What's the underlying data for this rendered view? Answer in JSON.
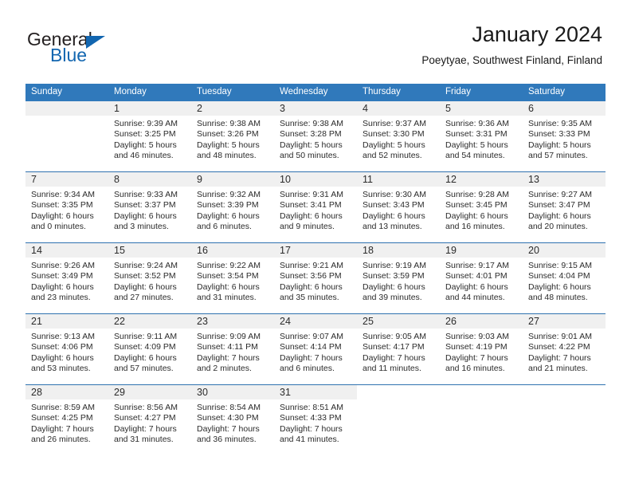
{
  "brand": {
    "name_part1": "General",
    "name_part2": "Blue",
    "accent_color": "#1266b0"
  },
  "header": {
    "title": "January 2024",
    "subtitle": "Poeytyae, Southwest Finland, Finland"
  },
  "calendar": {
    "header_bg": "#3079bb",
    "separator_color": "#2f72b0",
    "daynum_bg": "#f0f0f0",
    "weekday_headers": [
      "Sunday",
      "Monday",
      "Tuesday",
      "Wednesday",
      "Thursday",
      "Friday",
      "Saturday"
    ],
    "weeks": [
      [
        {
          "day": "",
          "lines": []
        },
        {
          "day": "1",
          "lines": [
            "Sunrise: 9:39 AM",
            "Sunset: 3:25 PM",
            "Daylight: 5 hours",
            "and 46 minutes."
          ]
        },
        {
          "day": "2",
          "lines": [
            "Sunrise: 9:38 AM",
            "Sunset: 3:26 PM",
            "Daylight: 5 hours",
            "and 48 minutes."
          ]
        },
        {
          "day": "3",
          "lines": [
            "Sunrise: 9:38 AM",
            "Sunset: 3:28 PM",
            "Daylight: 5 hours",
            "and 50 minutes."
          ]
        },
        {
          "day": "4",
          "lines": [
            "Sunrise: 9:37 AM",
            "Sunset: 3:30 PM",
            "Daylight: 5 hours",
            "and 52 minutes."
          ]
        },
        {
          "day": "5",
          "lines": [
            "Sunrise: 9:36 AM",
            "Sunset: 3:31 PM",
            "Daylight: 5 hours",
            "and 54 minutes."
          ]
        },
        {
          "day": "6",
          "lines": [
            "Sunrise: 9:35 AM",
            "Sunset: 3:33 PM",
            "Daylight: 5 hours",
            "and 57 minutes."
          ]
        }
      ],
      [
        {
          "day": "7",
          "lines": [
            "Sunrise: 9:34 AM",
            "Sunset: 3:35 PM",
            "Daylight: 6 hours",
            "and 0 minutes."
          ]
        },
        {
          "day": "8",
          "lines": [
            "Sunrise: 9:33 AM",
            "Sunset: 3:37 PM",
            "Daylight: 6 hours",
            "and 3 minutes."
          ]
        },
        {
          "day": "9",
          "lines": [
            "Sunrise: 9:32 AM",
            "Sunset: 3:39 PM",
            "Daylight: 6 hours",
            "and 6 minutes."
          ]
        },
        {
          "day": "10",
          "lines": [
            "Sunrise: 9:31 AM",
            "Sunset: 3:41 PM",
            "Daylight: 6 hours",
            "and 9 minutes."
          ]
        },
        {
          "day": "11",
          "lines": [
            "Sunrise: 9:30 AM",
            "Sunset: 3:43 PM",
            "Daylight: 6 hours",
            "and 13 minutes."
          ]
        },
        {
          "day": "12",
          "lines": [
            "Sunrise: 9:28 AM",
            "Sunset: 3:45 PM",
            "Daylight: 6 hours",
            "and 16 minutes."
          ]
        },
        {
          "day": "13",
          "lines": [
            "Sunrise: 9:27 AM",
            "Sunset: 3:47 PM",
            "Daylight: 6 hours",
            "and 20 minutes."
          ]
        }
      ],
      [
        {
          "day": "14",
          "lines": [
            "Sunrise: 9:26 AM",
            "Sunset: 3:49 PM",
            "Daylight: 6 hours",
            "and 23 minutes."
          ]
        },
        {
          "day": "15",
          "lines": [
            "Sunrise: 9:24 AM",
            "Sunset: 3:52 PM",
            "Daylight: 6 hours",
            "and 27 minutes."
          ]
        },
        {
          "day": "16",
          "lines": [
            "Sunrise: 9:22 AM",
            "Sunset: 3:54 PM",
            "Daylight: 6 hours",
            "and 31 minutes."
          ]
        },
        {
          "day": "17",
          "lines": [
            "Sunrise: 9:21 AM",
            "Sunset: 3:56 PM",
            "Daylight: 6 hours",
            "and 35 minutes."
          ]
        },
        {
          "day": "18",
          "lines": [
            "Sunrise: 9:19 AM",
            "Sunset: 3:59 PM",
            "Daylight: 6 hours",
            "and 39 minutes."
          ]
        },
        {
          "day": "19",
          "lines": [
            "Sunrise: 9:17 AM",
            "Sunset: 4:01 PM",
            "Daylight: 6 hours",
            "and 44 minutes."
          ]
        },
        {
          "day": "20",
          "lines": [
            "Sunrise: 9:15 AM",
            "Sunset: 4:04 PM",
            "Daylight: 6 hours",
            "and 48 minutes."
          ]
        }
      ],
      [
        {
          "day": "21",
          "lines": [
            "Sunrise: 9:13 AM",
            "Sunset: 4:06 PM",
            "Daylight: 6 hours",
            "and 53 minutes."
          ]
        },
        {
          "day": "22",
          "lines": [
            "Sunrise: 9:11 AM",
            "Sunset: 4:09 PM",
            "Daylight: 6 hours",
            "and 57 minutes."
          ]
        },
        {
          "day": "23",
          "lines": [
            "Sunrise: 9:09 AM",
            "Sunset: 4:11 PM",
            "Daylight: 7 hours",
            "and 2 minutes."
          ]
        },
        {
          "day": "24",
          "lines": [
            "Sunrise: 9:07 AM",
            "Sunset: 4:14 PM",
            "Daylight: 7 hours",
            "and 6 minutes."
          ]
        },
        {
          "day": "25",
          "lines": [
            "Sunrise: 9:05 AM",
            "Sunset: 4:17 PM",
            "Daylight: 7 hours",
            "and 11 minutes."
          ]
        },
        {
          "day": "26",
          "lines": [
            "Sunrise: 9:03 AM",
            "Sunset: 4:19 PM",
            "Daylight: 7 hours",
            "and 16 minutes."
          ]
        },
        {
          "day": "27",
          "lines": [
            "Sunrise: 9:01 AM",
            "Sunset: 4:22 PM",
            "Daylight: 7 hours",
            "and 21 minutes."
          ]
        }
      ],
      [
        {
          "day": "28",
          "lines": [
            "Sunrise: 8:59 AM",
            "Sunset: 4:25 PM",
            "Daylight: 7 hours",
            "and 26 minutes."
          ]
        },
        {
          "day": "29",
          "lines": [
            "Sunrise: 8:56 AM",
            "Sunset: 4:27 PM",
            "Daylight: 7 hours",
            "and 31 minutes."
          ]
        },
        {
          "day": "30",
          "lines": [
            "Sunrise: 8:54 AM",
            "Sunset: 4:30 PM",
            "Daylight: 7 hours",
            "and 36 minutes."
          ]
        },
        {
          "day": "31",
          "lines": [
            "Sunrise: 8:51 AM",
            "Sunset: 4:33 PM",
            "Daylight: 7 hours",
            "and 41 minutes."
          ]
        },
        {
          "day": "",
          "lines": [],
          "blank": true
        },
        {
          "day": "",
          "lines": [],
          "blank": true
        },
        {
          "day": "",
          "lines": [],
          "blank": true
        }
      ]
    ]
  }
}
